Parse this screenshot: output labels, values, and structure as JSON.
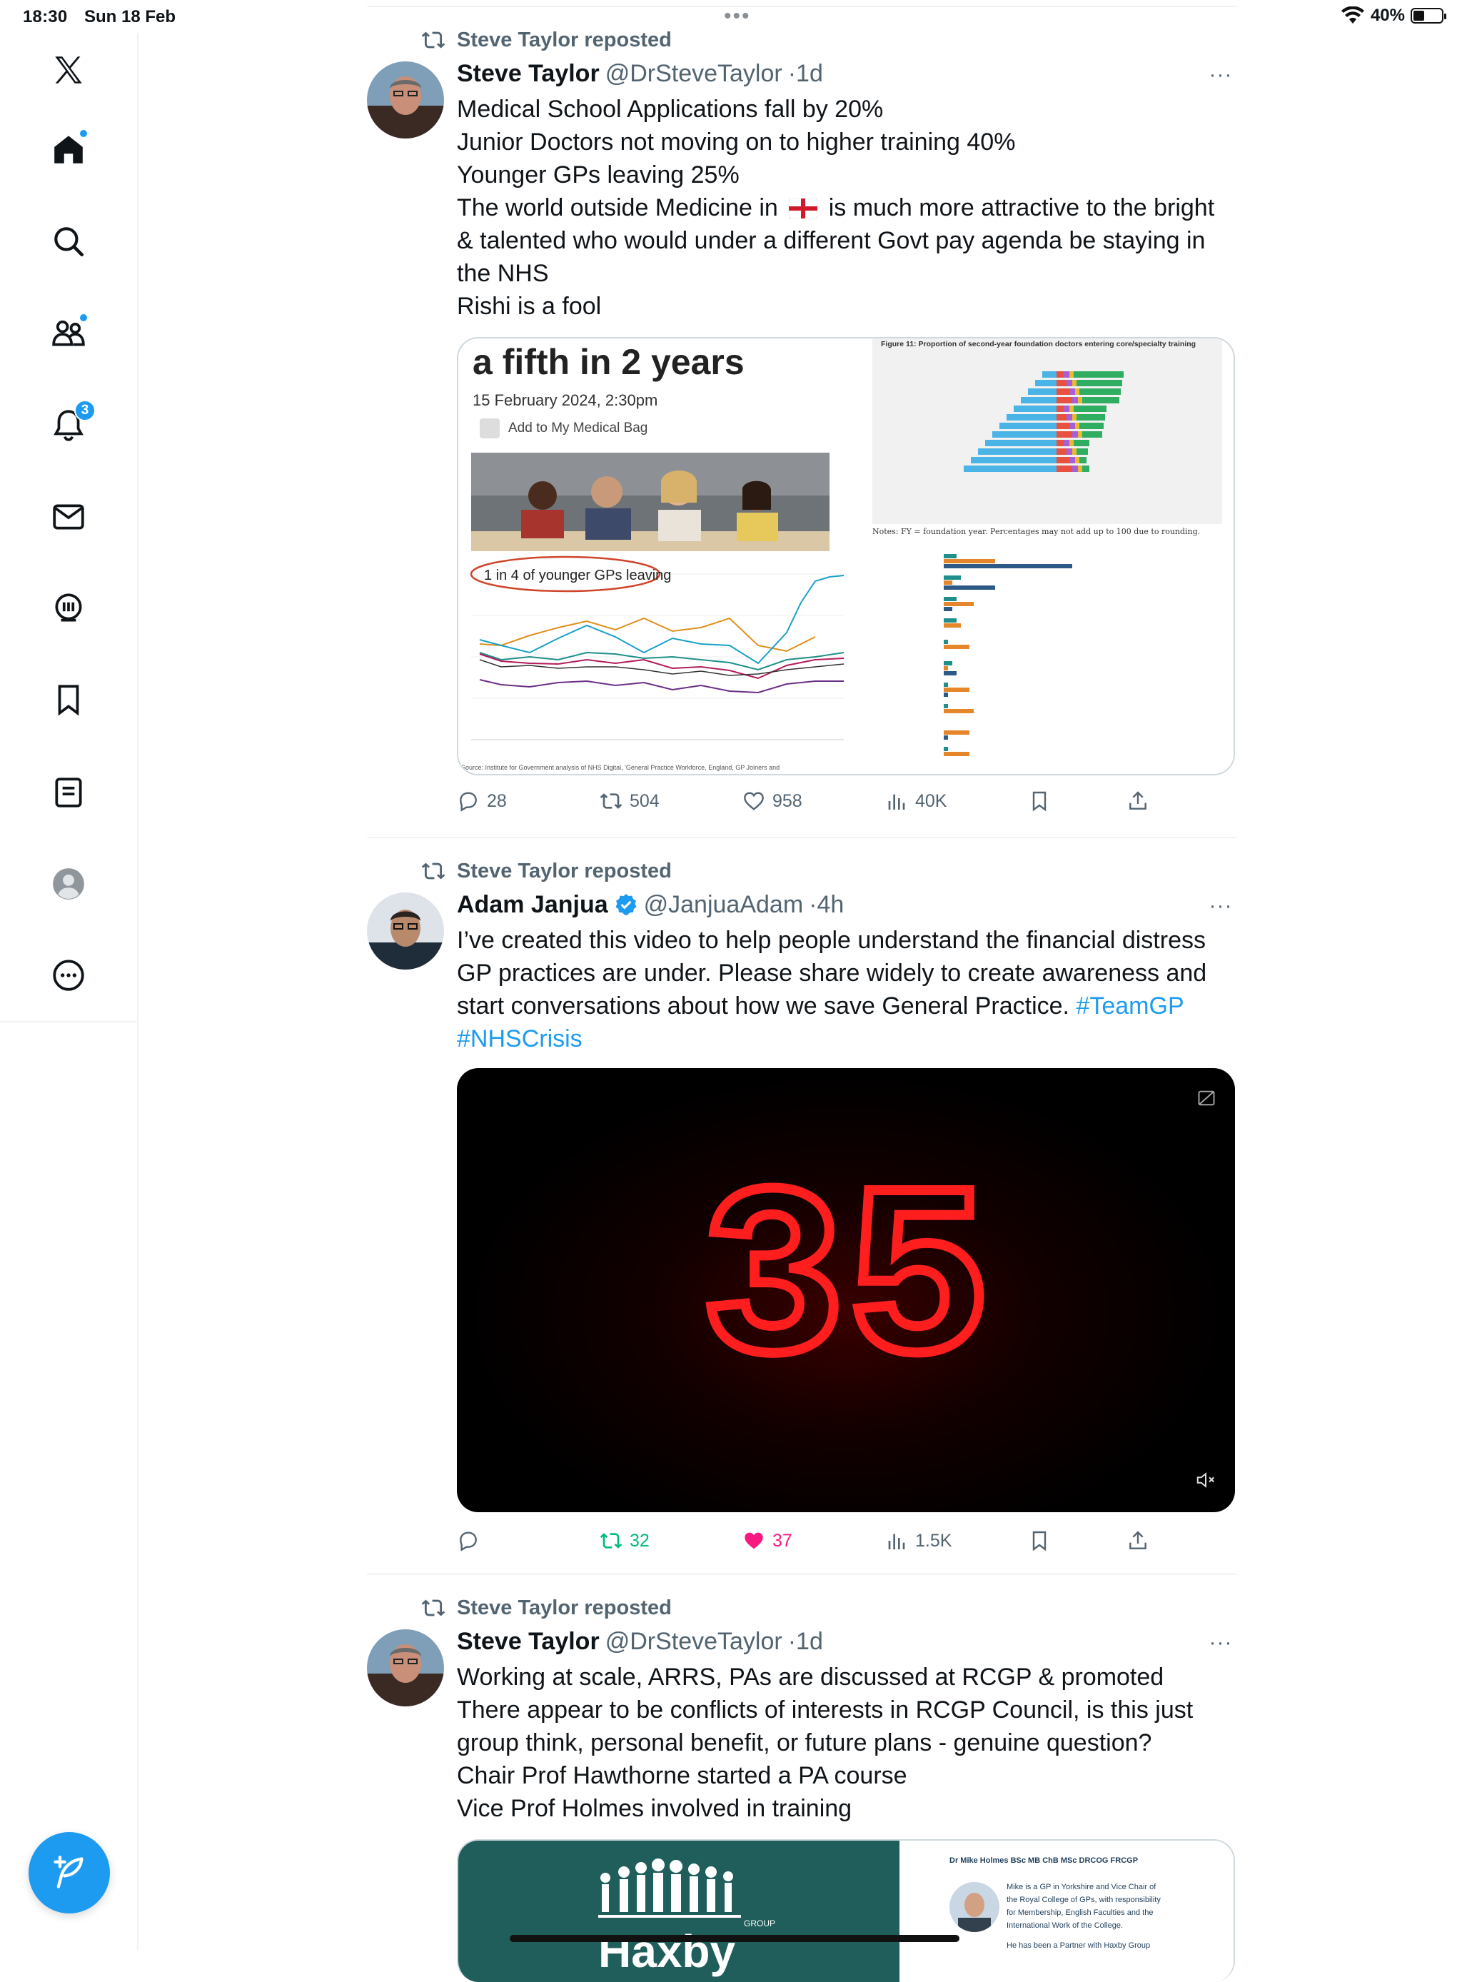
{
  "status_bar": {
    "time": "18:30",
    "date": "Sun 18 Feb",
    "battery": "40%",
    "battery_level": 0.4
  },
  "sidebar": {
    "items": [
      {
        "name": "x-logo-icon"
      },
      {
        "name": "home-icon"
      },
      {
        "name": "search-icon"
      },
      {
        "name": "communities-icon"
      },
      {
        "name": "notifications-icon",
        "badge": "3"
      },
      {
        "name": "messages-icon"
      },
      {
        "name": "grok-icon"
      },
      {
        "name": "bookmarks-icon"
      },
      {
        "name": "lists-icon"
      },
      {
        "name": "profile-icon"
      },
      {
        "name": "more-icon"
      }
    ],
    "compose": "compose-icon"
  },
  "feed": {
    "tweets": [
      {
        "repost_label": "Steve Taylor reposted",
        "name": "Steve Taylor",
        "handle": "@DrSteveTaylor",
        "time": "·1d",
        "lines": [
          "Medical School Applications fall by 20%",
          "Junior Doctors not moving on to higher training 40%",
          "Younger GPs leaving 25%",
          "The world outside Medicine in",
          "is much more attractive to the bright",
          "& talented who would under a different Govt pay agenda be staying in",
          "the NHS",
          "Rishi is a fool"
        ],
        "media": {
          "headline": "a fifth in 2 years",
          "date": "15 February 2024, 2:30pm",
          "bag_label": "Add to My Medical Bag",
          "chart_annotation": "1 in 4 of younger GPs leaving",
          "figure_title": "Figure 11: Proportion of second-year foundation doctors entering core/specialty training",
          "figure_notes": "Notes: FY = foundation year. Percentages may not add up to 100 due to rounding.",
          "source_text": "Source: Institute for Government analysis of NHS Digital, 'General Practice Workforce, England, GP Joiners and"
        },
        "replies": "28",
        "reposts": "504",
        "likes": "958",
        "views": "40K"
      },
      {
        "repost_label": "Steve Taylor reposted",
        "name": "Adam Janjua",
        "handle": "@JanjuaAdam",
        "time": "·4h",
        "lines": [
          "I’ve created this video to help people understand the financial distress",
          "GP practices are under. Please share widely to create awareness and",
          "start conversations about how we save General Practice."
        ],
        "hashtags": [
          "#TeamGP",
          "#NHSCrisis"
        ],
        "video_number": "35",
        "replies": "",
        "reposts": "32",
        "likes": "37",
        "views": "1.5K"
      },
      {
        "repost_label": "Steve Taylor reposted",
        "name": "Steve Taylor",
        "handle": "@DrSteveTaylor",
        "time": "·1d",
        "lines": [
          "Working at scale, ARRS, PAs are discussed at RCGP & promoted",
          "There appear to be conflicts of interests in RCGP Council, is this just",
          "group think, personal benefit, or future plans - genuine question?",
          "Chair Prof Hawthorne started a PA course",
          "Vice Prof Holmes involved  in training"
        ],
        "media": {
          "right_title": "Dr Mike Holmes BSc MB ChB MSc DRCOG FRCGP",
          "right_lines": [
            "Mike is a GP in Yorkshire and Vice Chair of",
            "the Royal College of GPs, with responsibility",
            "for Membership, English Faculties and the",
            "International Work of the College.",
            "He has been a Partner with Haxby Group"
          ],
          "logo_text": "Haxby",
          "logo_small": "GROUP"
        }
      }
    ]
  },
  "colors": {
    "accent": "#1d9bf0",
    "repost_green": "#00ba7c",
    "like_pink": "#f91880",
    "secondary_text": "#536471"
  }
}
